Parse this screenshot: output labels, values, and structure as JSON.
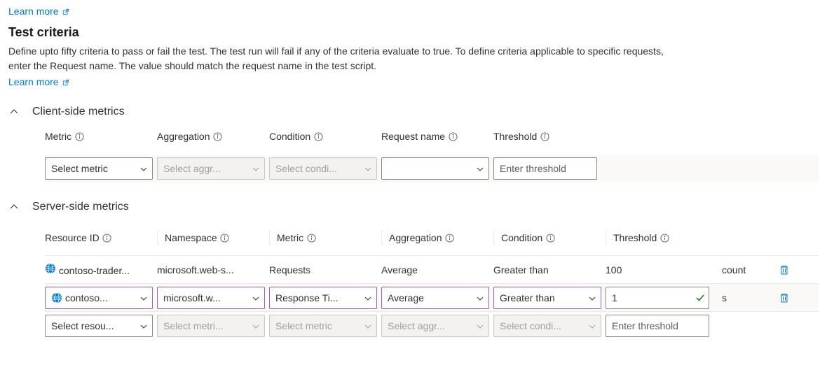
{
  "top_link": {
    "label": "Learn more"
  },
  "section": {
    "title": "Test criteria",
    "description": "Define upto fifty criteria to pass or fail the test. The test run will fail if any of the criteria evaluate to true. To define criteria applicable to specific requests, enter the Request name. The value should match the request name in the test script.",
    "learn_more": "Learn more"
  },
  "client": {
    "title": "Client-side metrics",
    "headers": {
      "metric": "Metric",
      "aggregation": "Aggregation",
      "condition": "Condition",
      "request_name": "Request name",
      "threshold": "Threshold"
    },
    "row": {
      "metric_placeholder": "Select metric",
      "aggregation_placeholder": "Select aggr...",
      "condition_placeholder": "Select condi...",
      "request_value": "",
      "threshold_placeholder": "Enter threshold"
    }
  },
  "server": {
    "title": "Server-side metrics",
    "headers": {
      "resource_id": "Resource ID",
      "namespace": "Namespace",
      "metric": "Metric",
      "aggregation": "Aggregation",
      "condition": "Condition",
      "threshold": "Threshold"
    },
    "rows": [
      {
        "resource": "contoso-trader...",
        "namespace": "microsoft.web-s...",
        "metric": "Requests",
        "aggregation": "Average",
        "condition": "Greater than",
        "threshold": "100",
        "unit": "count"
      },
      {
        "resource": "contoso...",
        "namespace": "microsoft.w...",
        "metric": "Response Ti...",
        "aggregation": "Average",
        "condition": "Greater than",
        "threshold": "1",
        "unit": "s"
      },
      {
        "resource_placeholder": "Select resou...",
        "namespace_placeholder": "Select metri...",
        "metric_placeholder": "Select metric",
        "aggregation_placeholder": "Select aggr...",
        "condition_placeholder": "Select condi...",
        "threshold_placeholder": "Enter threshold"
      }
    ]
  }
}
